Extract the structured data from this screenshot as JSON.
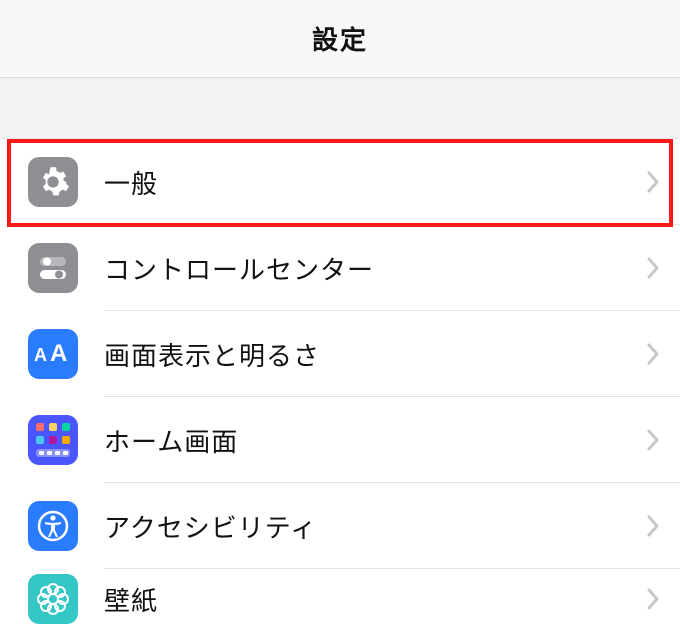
{
  "header": {
    "title": "設定"
  },
  "rows": [
    {
      "id": "general",
      "label": "一般"
    },
    {
      "id": "control-center",
      "label": "コントロールセンター"
    },
    {
      "id": "display",
      "label": "画面表示と明るさ"
    },
    {
      "id": "home-screen",
      "label": "ホーム画面"
    },
    {
      "id": "accessibility",
      "label": "アクセシビリティ"
    },
    {
      "id": "wallpaper",
      "label": "壁紙"
    }
  ]
}
